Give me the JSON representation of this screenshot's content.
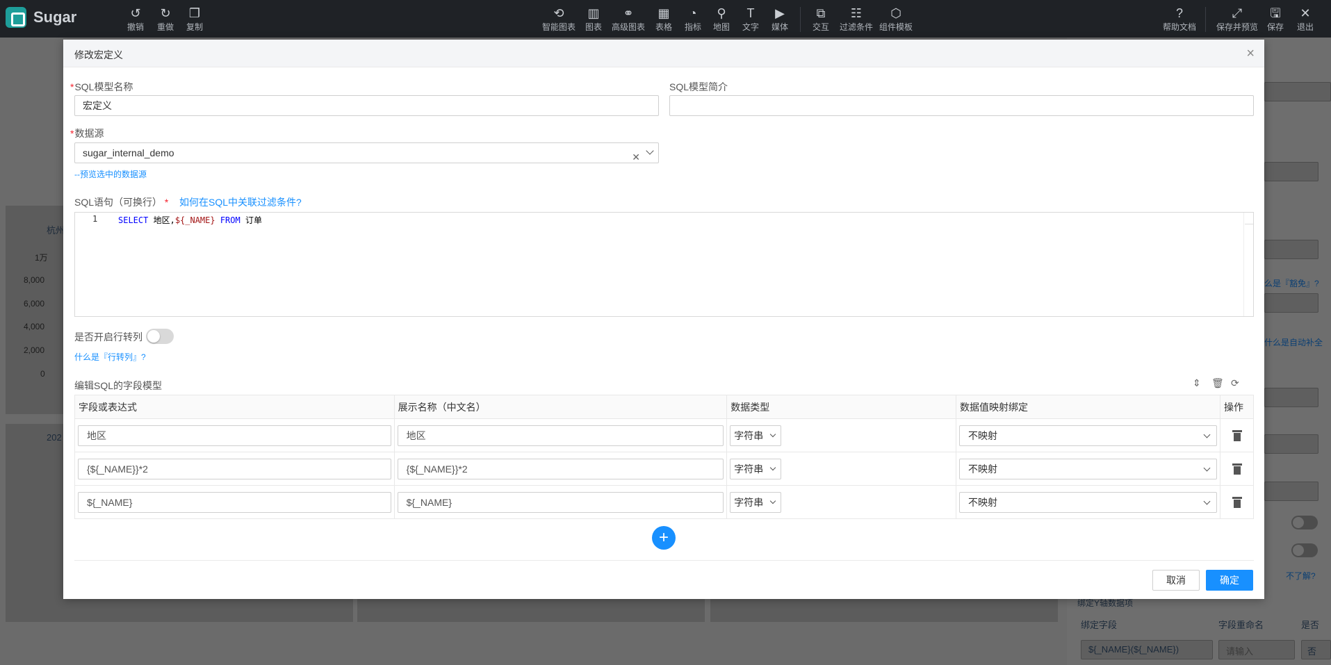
{
  "app": {
    "name": "Sugar"
  },
  "toolbar": {
    "left": [
      {
        "label": "撤销",
        "icon": "undo-icon",
        "glyph": "↺"
      },
      {
        "label": "重做",
        "icon": "redo-icon",
        "glyph": "↻"
      },
      {
        "label": "复制",
        "icon": "copy-icon",
        "glyph": "❐"
      }
    ],
    "center": [
      {
        "label": "智能图表",
        "icon": "smart-chart-icon",
        "glyph": "⟲"
      },
      {
        "label": "图表",
        "icon": "bar-chart-icon",
        "glyph": "▥"
      },
      {
        "label": "高级图表",
        "icon": "advanced-chart-icon",
        "glyph": "⚭"
      },
      {
        "label": "表格",
        "icon": "table-icon",
        "glyph": "▦"
      },
      {
        "label": "指标",
        "icon": "gauge-icon",
        "glyph": "◔"
      },
      {
        "label": "地图",
        "icon": "map-pin-icon",
        "glyph": "⚲"
      },
      {
        "label": "文字",
        "icon": "text-icon",
        "glyph": "T"
      },
      {
        "label": "媒体",
        "icon": "media-icon",
        "glyph": "▶"
      },
      {
        "label": "交互",
        "icon": "interaction-icon",
        "glyph": "⧉"
      },
      {
        "label": "过滤条件",
        "icon": "filter-icon",
        "glyph": "☷"
      },
      {
        "label": "组件模板",
        "icon": "template-icon",
        "glyph": "⬡"
      }
    ],
    "right": [
      {
        "label": "帮助文档",
        "icon": "help-icon",
        "glyph": "?"
      },
      {
        "label": "保存并预览",
        "icon": "expand-icon",
        "glyph": "⤢"
      },
      {
        "label": "保存",
        "icon": "save-icon",
        "glyph": "🖫"
      },
      {
        "label": "退出",
        "icon": "close-icon",
        "glyph": "✕"
      }
    ]
  },
  "background": {
    "chart_title": "杭州",
    "yticks": [
      "1万",
      "8,000",
      "6,000",
      "4,000",
      "2,000",
      "0"
    ],
    "year_label": "202",
    "right_links": [
      "么是『豁免』?",
      "什么是自动补全",
      "不了解?"
    ],
    "bind_y": "绑定Y轴数据项",
    "bind_field": "绑定字段",
    "field_rename": "字段重命名",
    "is_col": "是否",
    "bound_value": "${_NAME}(${_NAME})",
    "rename_placeholder": "请输入",
    "no_value": "否"
  },
  "modal": {
    "title": "修改宏定义",
    "model_name_label": "SQL模型名称",
    "model_name_value": "宏定义",
    "model_desc_label": "SQL模型简介",
    "model_desc_value": "",
    "datasource_label": "数据源",
    "datasource_value": "sugar_internal_demo",
    "preview_link": "--预览选中的数据源",
    "sql_label": "SQL语句（可换行）",
    "sql_help_link": "如何在SQL中关联过滤条件?",
    "sql_line_no": "1",
    "sql_code": {
      "kw1": "SELECT",
      "part1": " 地区,",
      "var": "${_NAME}",
      "kw2": " FROM",
      "part2": " 订单"
    },
    "pivot_label": "是否开启行转列",
    "pivot_on": false,
    "pivot_link": "什么是『行转列』?",
    "field_model_label": "编辑SQL的字段模型",
    "table": {
      "headers": [
        "字段或表达式",
        "展示名称（中文名）",
        "数据类型",
        "数据值映射绑定",
        "操作"
      ],
      "rows": [
        {
          "expr": "地区",
          "display": "地区",
          "type": "字符串",
          "mapping": "不映射"
        },
        {
          "expr": "{${_NAME}}*2",
          "display": "{${_NAME}}*2",
          "type": "字符串",
          "mapping": "不映射"
        },
        {
          "expr": "${_NAME}",
          "display": "${_NAME}",
          "type": "字符串",
          "mapping": "不映射"
        }
      ]
    },
    "cancel_label": "取消",
    "ok_label": "确定"
  },
  "colors": {
    "accent": "#1890ff",
    "topbar": "#1f2226",
    "required": "#f5222d"
  }
}
